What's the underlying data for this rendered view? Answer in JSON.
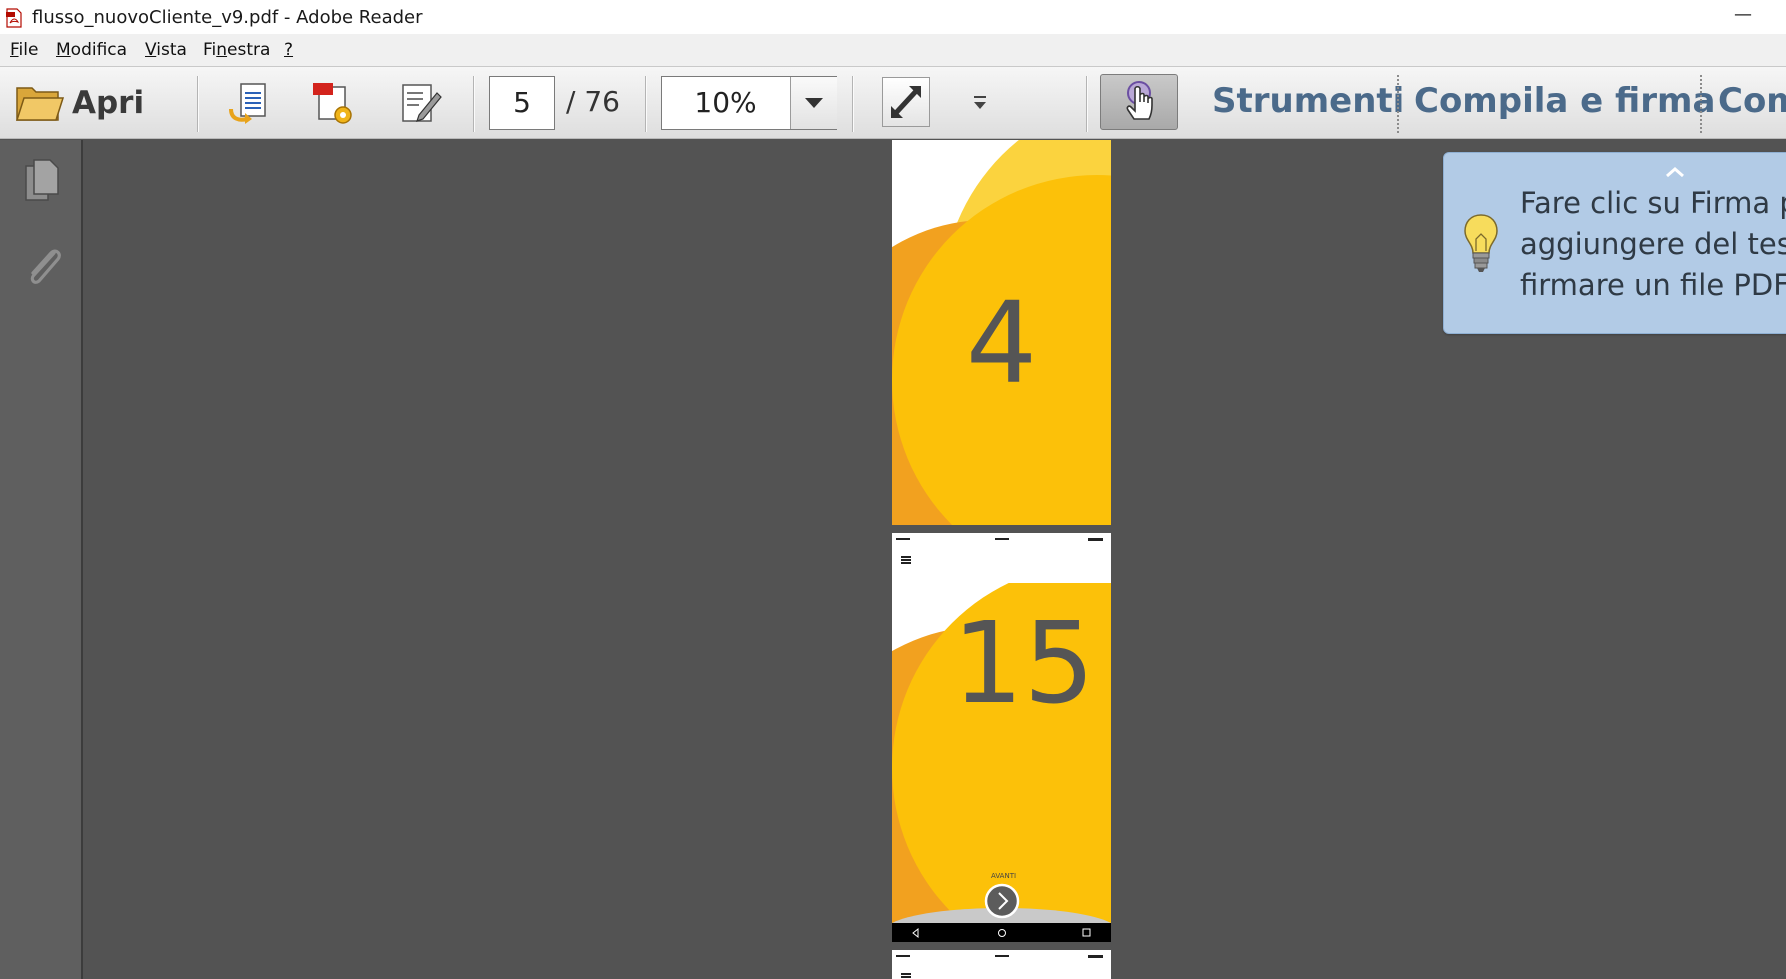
{
  "window": {
    "title": "flusso_nuovoCliente_v9.pdf - Adobe Reader",
    "minimize_glyph": "—"
  },
  "menu": {
    "items": [
      {
        "label": "File",
        "accel": "F"
      },
      {
        "label": "Modifica",
        "accel": "M"
      },
      {
        "label": "Vista",
        "accel": "V"
      },
      {
        "label": "Finestra",
        "accel": "n"
      },
      {
        "label": "?",
        "accel": "?"
      }
    ]
  },
  "toolbar": {
    "open_label": "Apri",
    "current_page": "5",
    "page_total": "/ 76",
    "zoom": "10%",
    "panels": {
      "tools": "Strumenti",
      "fill_sign": "Compila e firma",
      "comment": "Com"
    },
    "icons": [
      "folder-icon",
      "convert-to-pdf-icon",
      "create-pdf-icon",
      "edit-pdf-icon",
      "fit-page-icon",
      "more-tools-icon",
      "read-mode-hand-icon"
    ]
  },
  "navpane": {
    "icons": [
      "page-thumbnails-icon",
      "attachments-icon"
    ]
  },
  "pages": [
    {
      "number": "4"
    },
    {
      "number": "15",
      "button_label": "AVANTI"
    },
    {
      "number": ""
    }
  ],
  "tooltip": {
    "lines": [
      "Fare clic su Firma pe",
      "aggiungere del testo",
      "firmare un file PDF."
    ]
  },
  "colors": {
    "accent_blue": "#4b6a8a",
    "tooltip_bg": "#b2cbe6",
    "document_bg": "#535353",
    "page_yellow": "#fcc109",
    "page_orange": "#f2a11f",
    "page_light_yellow": "#fbd33e"
  }
}
